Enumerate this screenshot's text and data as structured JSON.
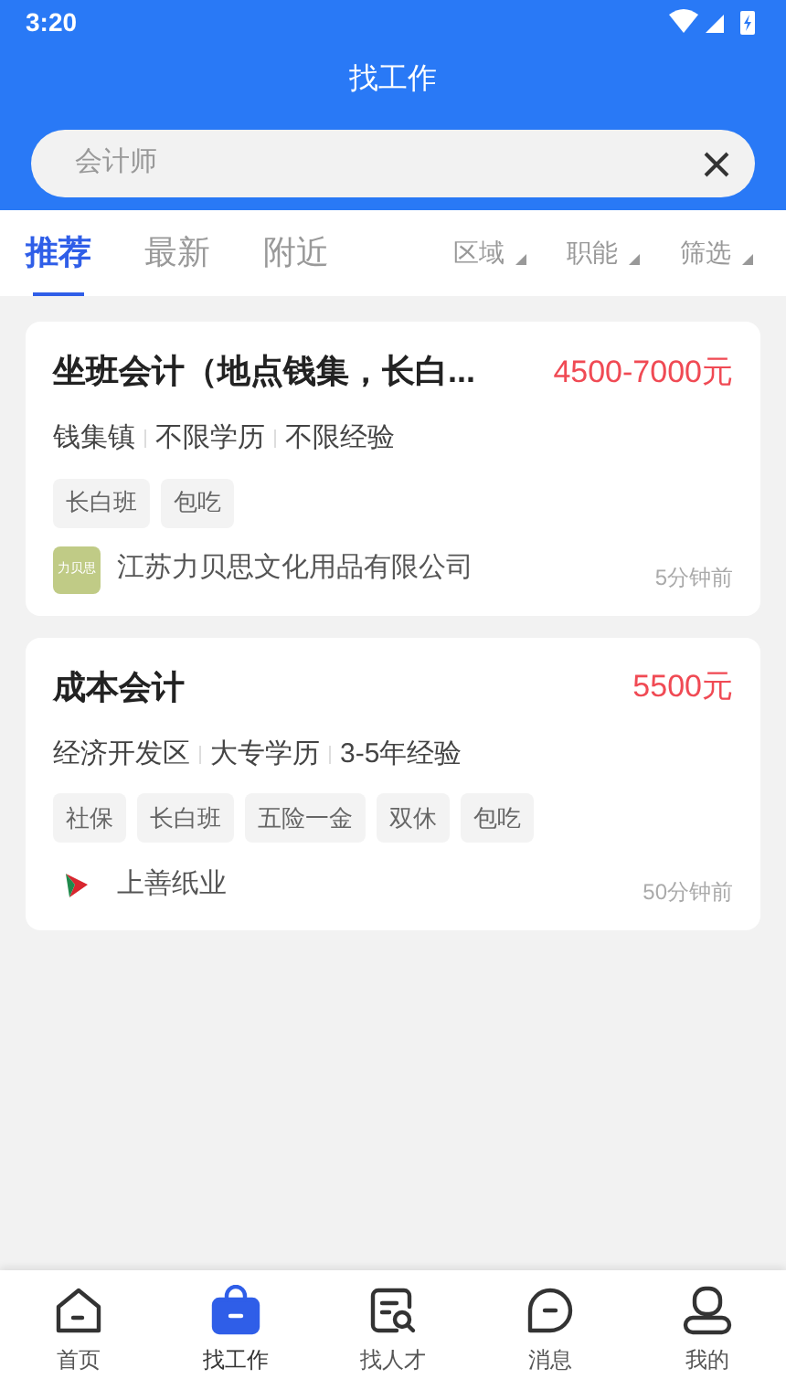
{
  "status_bar": {
    "time": "3:20"
  },
  "header": {
    "title": "找工作"
  },
  "search": {
    "value": "会计师"
  },
  "tabs": [
    {
      "label": "推荐",
      "selected": true
    },
    {
      "label": "最新",
      "selected": false
    },
    {
      "label": "附近",
      "selected": false
    }
  ],
  "filters": [
    "区域",
    "职能",
    "筛选"
  ],
  "jobs": [
    {
      "title": "坐班会计（地点钱集，长白...",
      "salary": "4500-7000元",
      "meta": [
        "钱集镇",
        "不限学历",
        "不限经验"
      ],
      "tags": [
        "长白班",
        "包吃"
      ],
      "company": "江苏力贝思文化用品有限公司",
      "logo": {
        "kind": "text",
        "text": "力贝思"
      },
      "time": "5分钟前"
    },
    {
      "title": "成本会计",
      "salary": "5500元",
      "meta": [
        "经济开发区",
        "大专学历",
        "3-5年经验"
      ],
      "tags": [
        "社保",
        "长白班",
        "五险一金",
        "双休",
        "包吃"
      ],
      "company": "上善纸业",
      "logo": {
        "kind": "mark"
      },
      "time": "50分钟前"
    }
  ],
  "nav": [
    {
      "label": "首页",
      "kind": "home",
      "selected": false
    },
    {
      "label": "找工作",
      "kind": "bag",
      "selected": true
    },
    {
      "label": "找人才",
      "kind": "search",
      "selected": false
    },
    {
      "label": "消息",
      "kind": "chat",
      "selected": false
    },
    {
      "label": "我的",
      "kind": "user",
      "selected": false
    }
  ]
}
